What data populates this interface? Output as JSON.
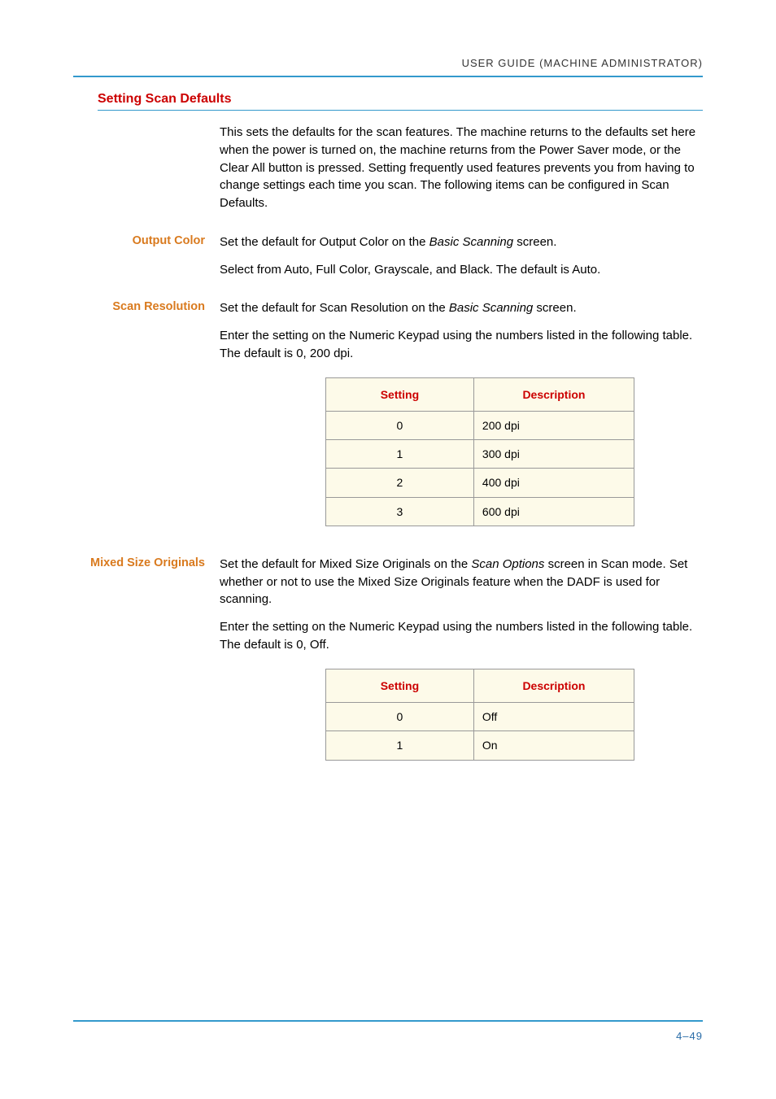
{
  "header": "USER GUIDE (MACHINE ADMINISTRATOR)",
  "sectionTitle": "Setting Scan Defaults",
  "intro": "This sets the defaults for the scan features. The machine returns to the defaults set here when the power is turned on, the machine returns from the Power Saver mode, or the Clear All button is pressed.  Setting frequently used features prevents you from having to change settings each time you scan. The following items can be configured in Scan Defaults.",
  "outputColor": {
    "label": "Output Color",
    "p1a": "Set the default for Output Color on the ",
    "p1i": "Basic Scanning",
    "p1b": " screen.",
    "p2": "Select from Auto, Full Color, Grayscale, and Black. The default is Auto."
  },
  "scanResolution": {
    "label": "Scan Resolution",
    "p1a": "Set the default for Scan Resolution on the ",
    "p1i": "Basic Scanning",
    "p1b": " screen.",
    "p2": "Enter the setting on the Numeric Keypad using the numbers listed in the following table. The default is 0, 200 dpi."
  },
  "table1": {
    "h1": "Setting",
    "h2": "Description",
    "rows": [
      {
        "s": "0",
        "d": "200 dpi"
      },
      {
        "s": "1",
        "d": "300 dpi"
      },
      {
        "s": "2",
        "d": "400 dpi"
      },
      {
        "s": "3",
        "d": "600 dpi"
      }
    ]
  },
  "mixedSize": {
    "label": "Mixed Size Originals",
    "p1a": "Set the default for Mixed Size Originals on the ",
    "p1i": "Scan Options",
    "p1b": " screen in Scan mode. Set whether or not to use the Mixed Size Originals feature when the DADF is used for scanning.",
    "p2": "Enter the setting on the Numeric Keypad using the numbers listed in the following table. The default is 0, Off."
  },
  "table2": {
    "h1": "Setting",
    "h2": "Description",
    "rows": [
      {
        "s": "0",
        "d": "Off"
      },
      {
        "s": "1",
        "d": "On"
      }
    ]
  },
  "pageNumber": "4–49"
}
